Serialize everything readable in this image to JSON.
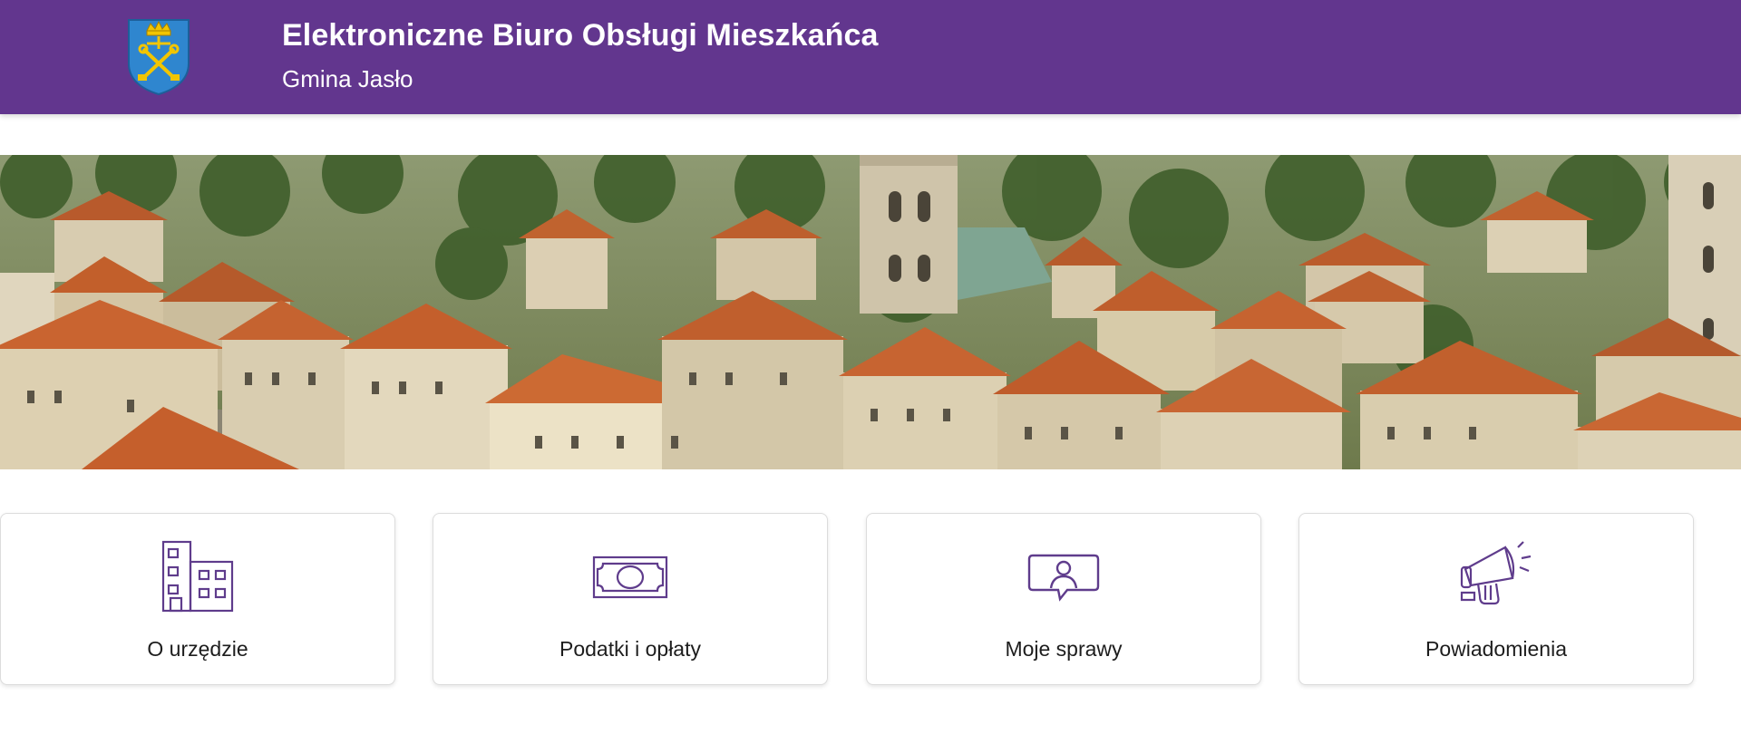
{
  "header": {
    "title": "Elektroniczne Biuro Obsługi Mieszkańca",
    "subtitle": "Gmina Jasło",
    "background_color": "#62368e",
    "logo_icon": "coat-of-arms-icon"
  },
  "banner": {
    "image": "aerial-town-photo"
  },
  "tiles": [
    {
      "label": "O urzędzie",
      "icon": "building-icon"
    },
    {
      "label": "Podatki i opłaty",
      "icon": "banknote-icon"
    },
    {
      "label": "Moje sprawy",
      "icon": "user-chat-icon"
    },
    {
      "label": "Powiadomienia",
      "icon": "megaphone-icon"
    }
  ],
  "colors": {
    "accent": "#62368e",
    "icon": "#5f3c8c"
  }
}
